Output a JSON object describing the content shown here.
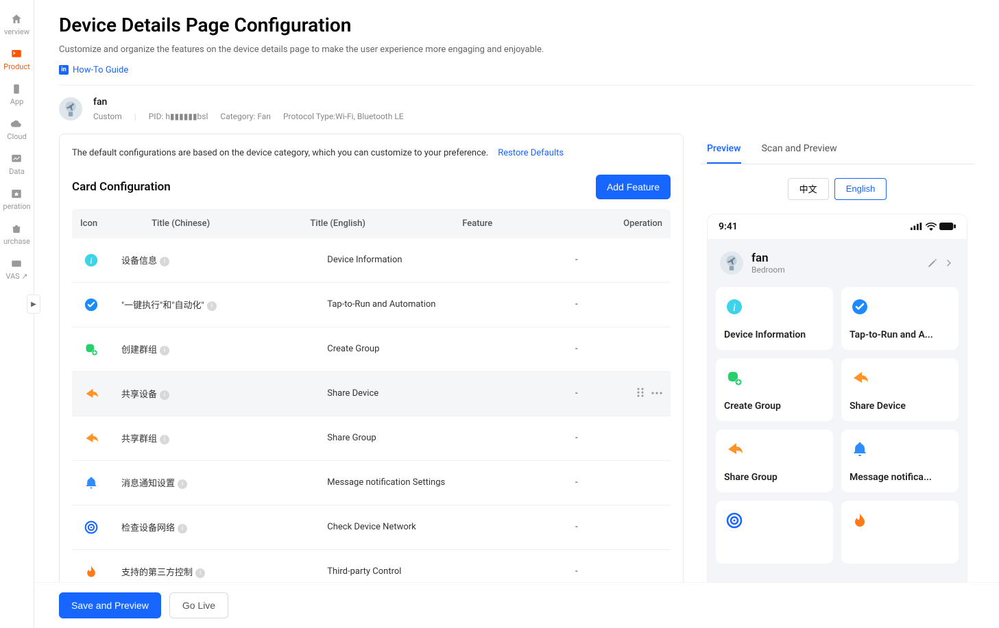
{
  "nav": [
    {
      "label": "verview",
      "icon": "home",
      "active": false
    },
    {
      "label": "Product",
      "icon": "product",
      "active": true
    },
    {
      "label": "App",
      "icon": "app",
      "active": false
    },
    {
      "label": "Cloud",
      "icon": "cloud",
      "active": false
    },
    {
      "label": "Data",
      "icon": "data",
      "active": false
    },
    {
      "label": "peration",
      "icon": "star",
      "active": false
    },
    {
      "label": "urchase",
      "icon": "bag",
      "active": false
    },
    {
      "label": "VAS ↗",
      "icon": "vas",
      "active": false
    }
  ],
  "page": {
    "title": "Device Details Page Configuration",
    "subtitle": "Customize and organize the features on the device details page to make the user experience more engaging and enjoyable.",
    "howto": "How-To Guide"
  },
  "product": {
    "name": "fan",
    "type": "Custom",
    "pid_label": "PID: h▮▮▮▮▮▮bsl",
    "category": "Category: Fan",
    "protocol": "Protocol Type:Wi-Fi, Bluetooth LE"
  },
  "notice": "The default configurations are based on the device category, which you can customize to your preference.",
  "restore_label": "Restore Defaults",
  "card_section_title": "Card Configuration",
  "add_feature_label": "Add Feature",
  "columns": {
    "icon": "Icon",
    "title_cn": "Title (Chinese)",
    "title_en": "Title (English)",
    "feature": "Feature",
    "operation": "Operation"
  },
  "rows": [
    {
      "icon": "info",
      "icon_bg": "#3dd3e8",
      "title_cn": "设备信息",
      "title_en": "Device Information",
      "feature": "-"
    },
    {
      "icon": "check",
      "icon_bg": "#1d8bff",
      "title_cn": "\"一键执行\"和\"自动化\"",
      "title_en": "Tap-to-Run and Automation",
      "feature": "-"
    },
    {
      "icon": "group",
      "icon_bg": "#26d06b",
      "title_cn": "创建群组",
      "title_en": "Create Group",
      "feature": "-"
    },
    {
      "icon": "share",
      "icon_bg": "#ff9429",
      "title_cn": "共享设备",
      "title_en": "Share Device",
      "feature": "-",
      "highlight": true,
      "ops": true
    },
    {
      "icon": "share",
      "icon_bg": "#ff9429",
      "title_cn": "共享群组",
      "title_en": "Share Group",
      "feature": "-"
    },
    {
      "icon": "bell",
      "icon_bg": "#2f8cff",
      "title_cn": "消息通知设置",
      "title_en": "Message notification Settings",
      "feature": "-"
    },
    {
      "icon": "network",
      "icon_bg": "#1766ff",
      "title_cn": "检查设备网络",
      "title_en": "Check Device Network",
      "feature": "-"
    },
    {
      "icon": "flame",
      "icon_bg": "#ff7b1a",
      "title_cn": "支持的第三方控制",
      "title_en": "Third-party Control",
      "feature": "-"
    }
  ],
  "preview": {
    "tabs": [
      "Preview",
      "Scan and Preview"
    ],
    "active_tab": "Preview",
    "langs": [
      "中文",
      "English"
    ],
    "active_lang": "English",
    "clock": "9:41",
    "device_name": "fan",
    "device_room": "Bedroom",
    "cards": [
      {
        "icon": "info",
        "bg": "#3dd3e8",
        "label": "Device Information"
      },
      {
        "icon": "check",
        "bg": "#1d8bff",
        "label": "Tap-to-Run and A..."
      },
      {
        "icon": "group",
        "bg": "#26d06b",
        "label": "Create Group"
      },
      {
        "icon": "share",
        "bg": "#ff9429",
        "label": "Share Device"
      },
      {
        "icon": "share",
        "bg": "#ff9429",
        "label": "Share Group"
      },
      {
        "icon": "bell",
        "bg": "#2f8cff",
        "label": "Message notifica..."
      },
      {
        "icon": "network",
        "bg": "#1766ff",
        "label": ""
      },
      {
        "icon": "flame",
        "bg": "#ff7b1a",
        "label": ""
      }
    ]
  },
  "footer": {
    "save": "Save and Preview",
    "golive": "Go Live"
  }
}
